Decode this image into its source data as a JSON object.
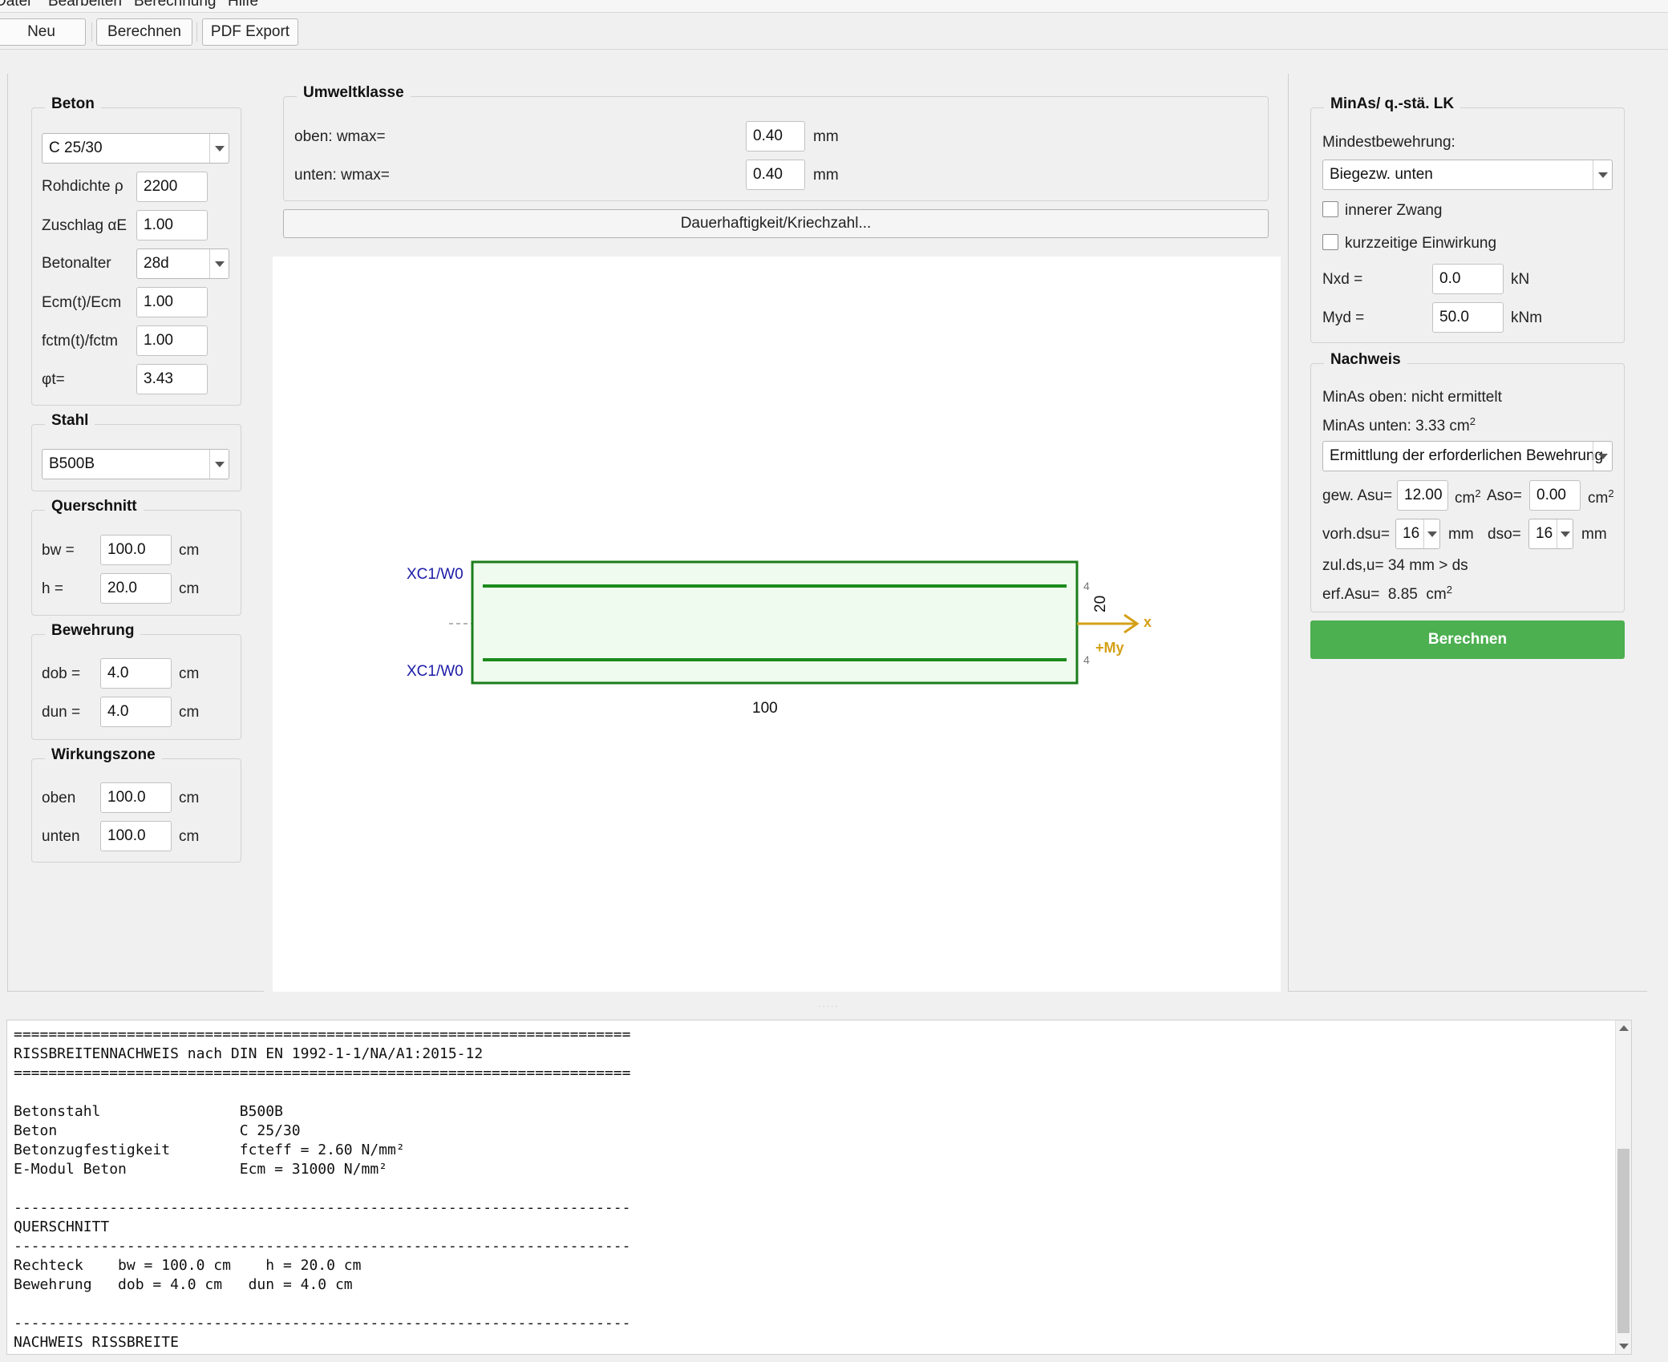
{
  "menu": {
    "items": [
      "Datei",
      "Bearbeiten",
      "Berechnung",
      "Hilfe"
    ]
  },
  "toolbar": {
    "new_label": "Neu",
    "calc_label": "Berechnen",
    "pdf_label": "PDF Export"
  },
  "beton": {
    "title": "Beton",
    "class_value": "C 25/30",
    "rohdichte_label": "Rohdichte ρ",
    "rohdichte_value": "2200",
    "zuschlag_label": "Zuschlag αE",
    "zuschlag_value": "1.00",
    "alter_label": "Betonalter",
    "alter_value": "28d",
    "ecm_label": "Ecm(t)/Ecm",
    "ecm_value": "1.00",
    "fctm_label": "fctm(t)/fctm",
    "fctm_value": "1.00",
    "phi_label": "φt=",
    "phi_value": "3.43"
  },
  "stahl": {
    "title": "Stahl",
    "value": "B500B"
  },
  "querschnitt": {
    "title": "Querschnitt",
    "bw_label": "bw =",
    "bw_value": "100.0",
    "h_label": "h =",
    "h_value": "20.0",
    "unit": "cm"
  },
  "bewehrung": {
    "title": "Bewehrung",
    "dob_label": "dob =",
    "dob_value": "4.0",
    "dun_label": "dun =",
    "dun_value": "4.0",
    "unit": "cm"
  },
  "wirkungszone": {
    "title": "Wirkungszone",
    "oben_label": "oben",
    "oben_value": "100.0",
    "unten_label": "unten",
    "unten_value": "100.0",
    "unit": "cm"
  },
  "umweltklasse": {
    "title": "Umweltklasse",
    "oben_label": "oben: wmax=",
    "oben_value": "0.40",
    "unten_label": "unten: wmax=",
    "unten_value": "0.40",
    "unit": "mm",
    "button_label": "Dauerhaftigkeit/Kriechzahl..."
  },
  "drawing": {
    "top_class": "XC1/W0",
    "bottom_class": "XC1/W0",
    "top_cover": "4",
    "bottom_cover": "4",
    "height_label": "20",
    "width_label": "100",
    "axis_label": "x",
    "moment_label": "+My",
    "colors": {
      "section": "#1b7d1b",
      "fill": "#eefbee",
      "axis": "#d4a017",
      "class_text": "#1a1aa6"
    }
  },
  "minas": {
    "title": "MinAs/ q.-stä. LK",
    "mindest_label": "Mindestbewehrung:",
    "mindest_value": "Biegezw. unten",
    "zwang_label": "innerer Zwang",
    "kurz_label": "kurzzeitige Einwirkung",
    "nxd_label": "Nxd =",
    "nxd_value": "0.0",
    "nxd_unit": "kN",
    "myd_label": "Myd =",
    "myd_value": "50.0",
    "myd_unit": "kNm"
  },
  "nachweis": {
    "title": "Nachweis",
    "minas_oben": "MinAs oben: nicht ermittelt",
    "minas_unten": "MinAs unten: 3.33 cm",
    "mode_value": "Ermittlung der erforderlichen Bewehrung",
    "asu_label": "gew. Asu=",
    "asu_value": "12.00",
    "aso_label": "Aso=",
    "aso_value": "0.00",
    "area_unit": "cm",
    "dsu_label": "vorh.dsu=",
    "dsu_value": "16",
    "dso_label": "dso=",
    "dso_value": "16",
    "mm_unit": "mm",
    "zul_text": "zul.ds,u=  34  mm  > ds",
    "erf_text": "erf.Asu=  8.85  cm"
  },
  "calc_button": "Berechnen",
  "output": {
    "text": "=======================================================================\nRISSBREITENNACHWEIS nach DIN EN 1992-1-1/NA/A1:2015-12\n=======================================================================\n\nBetonstahl                B500B\nBeton                     C 25/30\nBetonzugfestigkeit        fcteff = 2.60 N/mm²\nE-Modul Beton             Ecm = 31000 N/mm²\n\n-----------------------------------------------------------------------\nQUERSCHNITT\n-----------------------------------------------------------------------\nRechteck    bw = 100.0 cm    h = 20.0 cm\nBewehrung   dob = 4.0 cm   dun = 4.0 cm\n\n-----------------------------------------------------------------------\nNACHWEIS RISSBREITE"
  }
}
